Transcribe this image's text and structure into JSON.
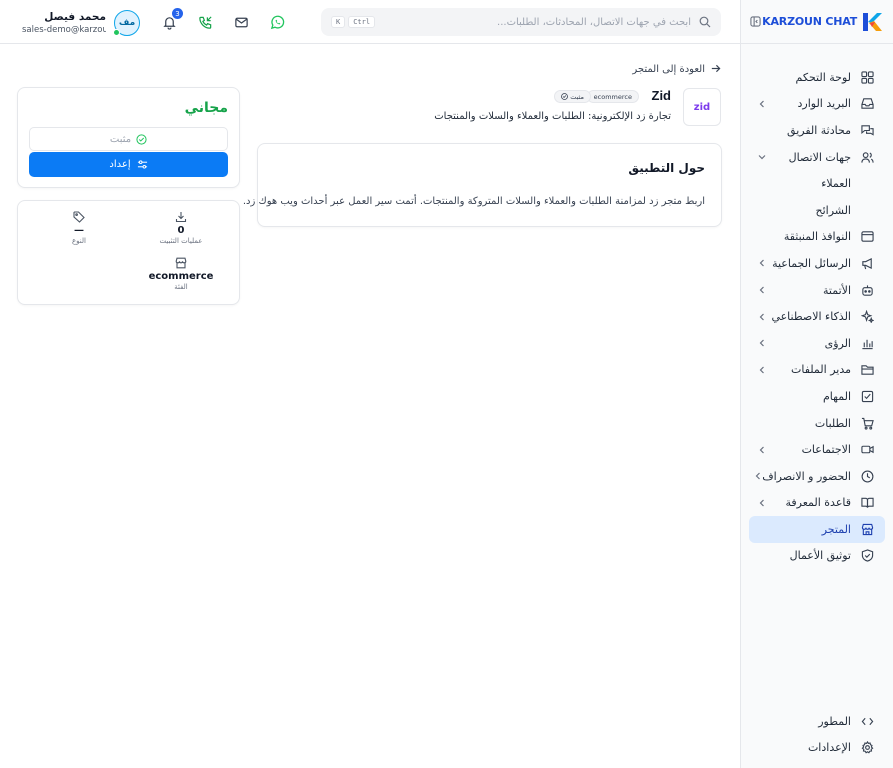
{
  "brand": {
    "name": "KARZOUN CHAT"
  },
  "sidebar": {
    "items": [
      {
        "label": "لوحة التحكم",
        "icon": "dashboard-icon",
        "chevron": false
      },
      {
        "label": "البريد الوارد",
        "icon": "inbox-icon",
        "chevron": true
      },
      {
        "label": "محادثة الفريق",
        "icon": "team-chat-icon",
        "chevron": false
      },
      {
        "label": "جهات الاتصال",
        "icon": "contacts-icon",
        "chevron": true,
        "expanded": true
      },
      {
        "label": "العملاء",
        "sub": true
      },
      {
        "label": "الشرائح",
        "sub": true
      },
      {
        "label": "النوافذ المنبثقة",
        "icon": "popup-icon",
        "chevron": false
      },
      {
        "label": "الرسائل الجماعية",
        "icon": "megaphone-icon",
        "chevron": true
      },
      {
        "label": "الأتمتة",
        "icon": "bot-icon",
        "chevron": true
      },
      {
        "label": "الذكاء الاصطناعي",
        "icon": "sparkles-icon",
        "chevron": true
      },
      {
        "label": "الرؤى",
        "icon": "chart-icon",
        "chevron": true
      },
      {
        "label": "مدير الملفات",
        "icon": "folder-icon",
        "chevron": true
      },
      {
        "label": "المهام",
        "icon": "task-icon",
        "chevron": false
      },
      {
        "label": "الطلبات",
        "icon": "cart-icon",
        "chevron": false
      },
      {
        "label": "الاجتماعات",
        "icon": "video-icon",
        "chevron": true
      },
      {
        "label": "الحضور و الانصراف",
        "icon": "clock-icon",
        "chevron": true
      },
      {
        "label": "قاعدة المعرفة",
        "icon": "book-icon",
        "chevron": true
      },
      {
        "label": "المتجر",
        "icon": "store-icon",
        "chevron": false,
        "active": true
      },
      {
        "label": "توثيق الأعمال",
        "icon": "shield-check-icon",
        "chevron": false
      }
    ],
    "bottom": [
      {
        "label": "المطور",
        "icon": "code-icon"
      },
      {
        "label": "الإعدادات",
        "icon": "gear-icon"
      }
    ]
  },
  "header": {
    "search_placeholder": "ابحث في جهات الاتصال، المحادثات، الطلبات...",
    "shortcut_ctrl": "Ctrl",
    "shortcut_key": "K",
    "notifications_count": "3",
    "user": {
      "initials": "مف",
      "name": "محمد فيصل",
      "email": "sales-demo@karzoun..."
    }
  },
  "main": {
    "back_label": "العودة إلى المتجر",
    "app": {
      "logo_text": "zid",
      "name": "Zid",
      "category": "ecommerce",
      "installed": "مثبت",
      "description": "تجارة زد الإلكترونية: الطلبات والعملاء والسلات والمنتجات"
    },
    "about": {
      "title": "حول التطبيق",
      "text": "اربط متجر زد لمزامنة الطلبات والعملاء والسلات المتروكة والمنتجات. أتمت سير العمل عبر أحداث ويب هوك زد."
    },
    "pricing": {
      "price": "مجاني",
      "installed_label": "مثبت",
      "setup_label": "إعداد"
    },
    "stats": {
      "installs_value": "0",
      "installs_label": "عمليات التثبيت",
      "type_value": "—",
      "type_label": "النوع",
      "category_value": "ecommerce",
      "category_label": "الفئة"
    }
  },
  "colors": {
    "accent": "#0b7bf5",
    "active_bg": "#dbeafe",
    "price_green": "#16a34a",
    "whatsapp_green": "#22c55e"
  }
}
